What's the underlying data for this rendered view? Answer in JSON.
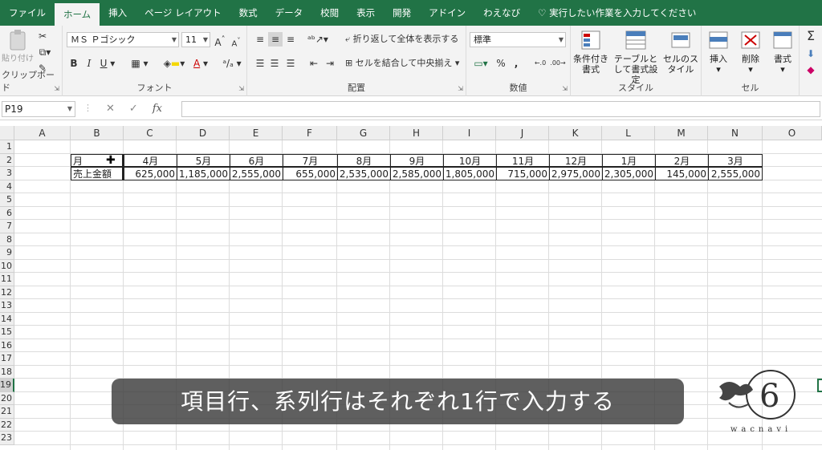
{
  "tabs": [
    "ファイル",
    "ホーム",
    "挿入",
    "ページ レイアウト",
    "数式",
    "データ",
    "校閲",
    "表示",
    "開発",
    "アドイン",
    "わえなび"
  ],
  "tell_me": "実行したい作業を入力してください",
  "ribbon": {
    "clipboard": {
      "paste": "貼り付け",
      "label": "クリップボード"
    },
    "font": {
      "name": "ＭＳ Ｐゴシック",
      "size": "11",
      "label": "フォント",
      "bold": "B",
      "italic": "I",
      "underline": "U"
    },
    "alignment": {
      "wrap": "折り返して全体を表示する",
      "merge": "セルを結合して中央揃え",
      "label": "配置"
    },
    "number": {
      "format": "標準",
      "label": "数値",
      "percent": "%",
      "comma": ","
    },
    "styles": {
      "conditional": "条件付き書式",
      "table": "テーブルとして書式設定",
      "cell": "セルのスタイル",
      "label": "スタイル"
    },
    "cells": {
      "insert": "挿入",
      "delete": "削除",
      "format": "書式",
      "label": "セル"
    },
    "editing": {
      "sum": "Σ"
    }
  },
  "formula_bar": {
    "name_box": "P19",
    "fx": "fx",
    "cancel": "✕",
    "enter": "✓",
    "value": ""
  },
  "columns": [
    "A",
    "B",
    "C",
    "D",
    "E",
    "F",
    "G",
    "H",
    "I",
    "J",
    "K",
    "L",
    "M",
    "N",
    "O"
  ],
  "rows": [
    "1",
    "2",
    "3",
    "4",
    "5",
    "6",
    "7",
    "8",
    "9",
    "10",
    "11",
    "12",
    "13",
    "14",
    "15",
    "16",
    "17",
    "18",
    "19",
    "20",
    "21",
    "22",
    "23"
  ],
  "table": {
    "header_label": "月",
    "row_label": "売上金額",
    "months": [
      "4月",
      "5月",
      "6月",
      "7月",
      "8月",
      "9月",
      "10月",
      "11月",
      "12月",
      "1月",
      "2月",
      "3月"
    ],
    "values": [
      "625,000",
      "1,185,000",
      "2,555,000",
      "655,000",
      "2,535,000",
      "2,585,000",
      "1,805,000",
      "715,000",
      "2,975,000",
      "2,305,000",
      "145,000",
      "2,555,000"
    ]
  },
  "caption": "項目行、系列行はそれぞれ1行で入力する",
  "logo_text": "wacnavi",
  "colors": {
    "accent": "#217346",
    "ribbon_bg": "#f3f3f3",
    "grid_line": "#dcdcdc",
    "caption_bg": "#3c3c3c"
  }
}
